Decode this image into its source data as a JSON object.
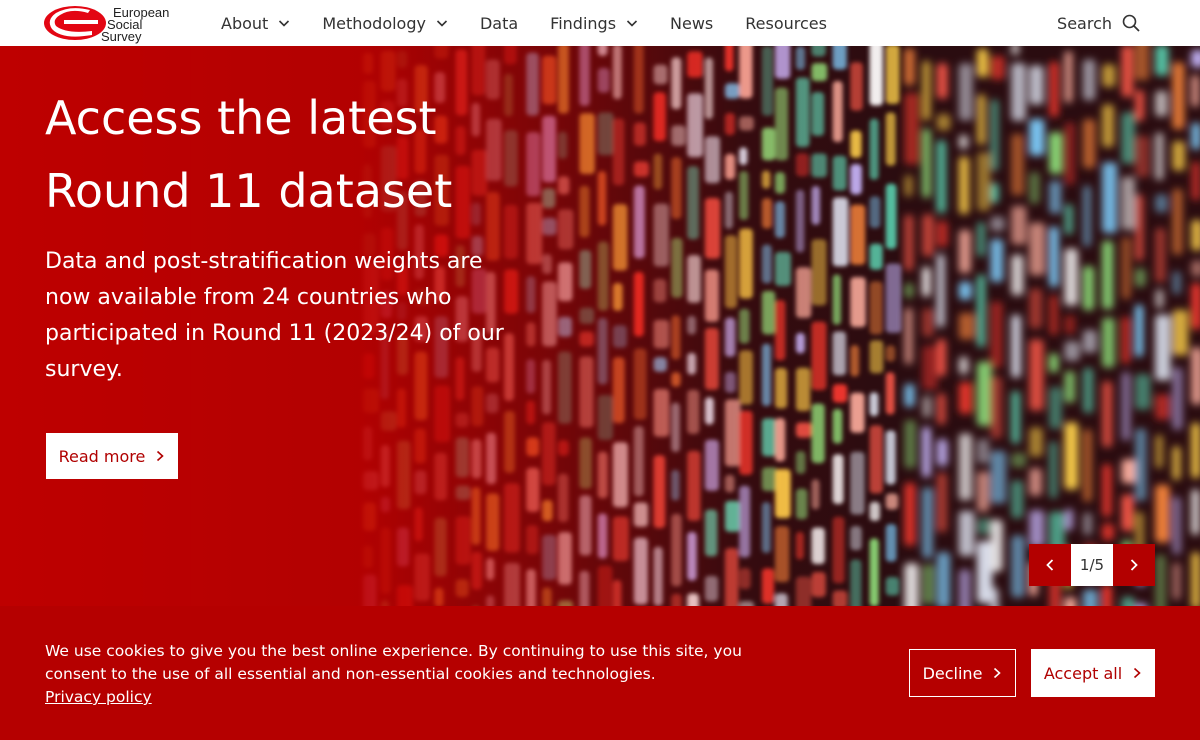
{
  "logo": {
    "line1": "European",
    "line2": "Social",
    "line3": "Survey",
    "brand_color": "#e30613"
  },
  "nav": {
    "items": [
      {
        "label": "About",
        "has_dropdown": true
      },
      {
        "label": "Methodology",
        "has_dropdown": true
      },
      {
        "label": "Data",
        "has_dropdown": false
      },
      {
        "label": "Findings",
        "has_dropdown": true
      },
      {
        "label": "News",
        "has_dropdown": false
      },
      {
        "label": "Resources",
        "has_dropdown": false
      }
    ],
    "search_label": "Search",
    "search_icon": "search-icon",
    "dropdown_icon": "chevron-down-icon"
  },
  "hero": {
    "title_line1": "Access the latest",
    "title_line2": "Round 11 dataset",
    "body": "Data and post-stratification weights are now available from 24 countries who participated in Round 11 (2023/24) of our survey.",
    "read_more_label": "Read more",
    "slide_counter": "1/5",
    "prev_icon": "chevron-left-icon",
    "next_icon": "chevron-right-icon",
    "accent_color": "#b50000"
  },
  "cookie": {
    "message": "We use cookies to give you the best online experience. By continuing to use this site, you consent to the use of all essential and non-essential cookies and technologies.",
    "privacy_link": "Privacy policy",
    "decline_label": "Decline",
    "accept_label": "Accept all"
  }
}
